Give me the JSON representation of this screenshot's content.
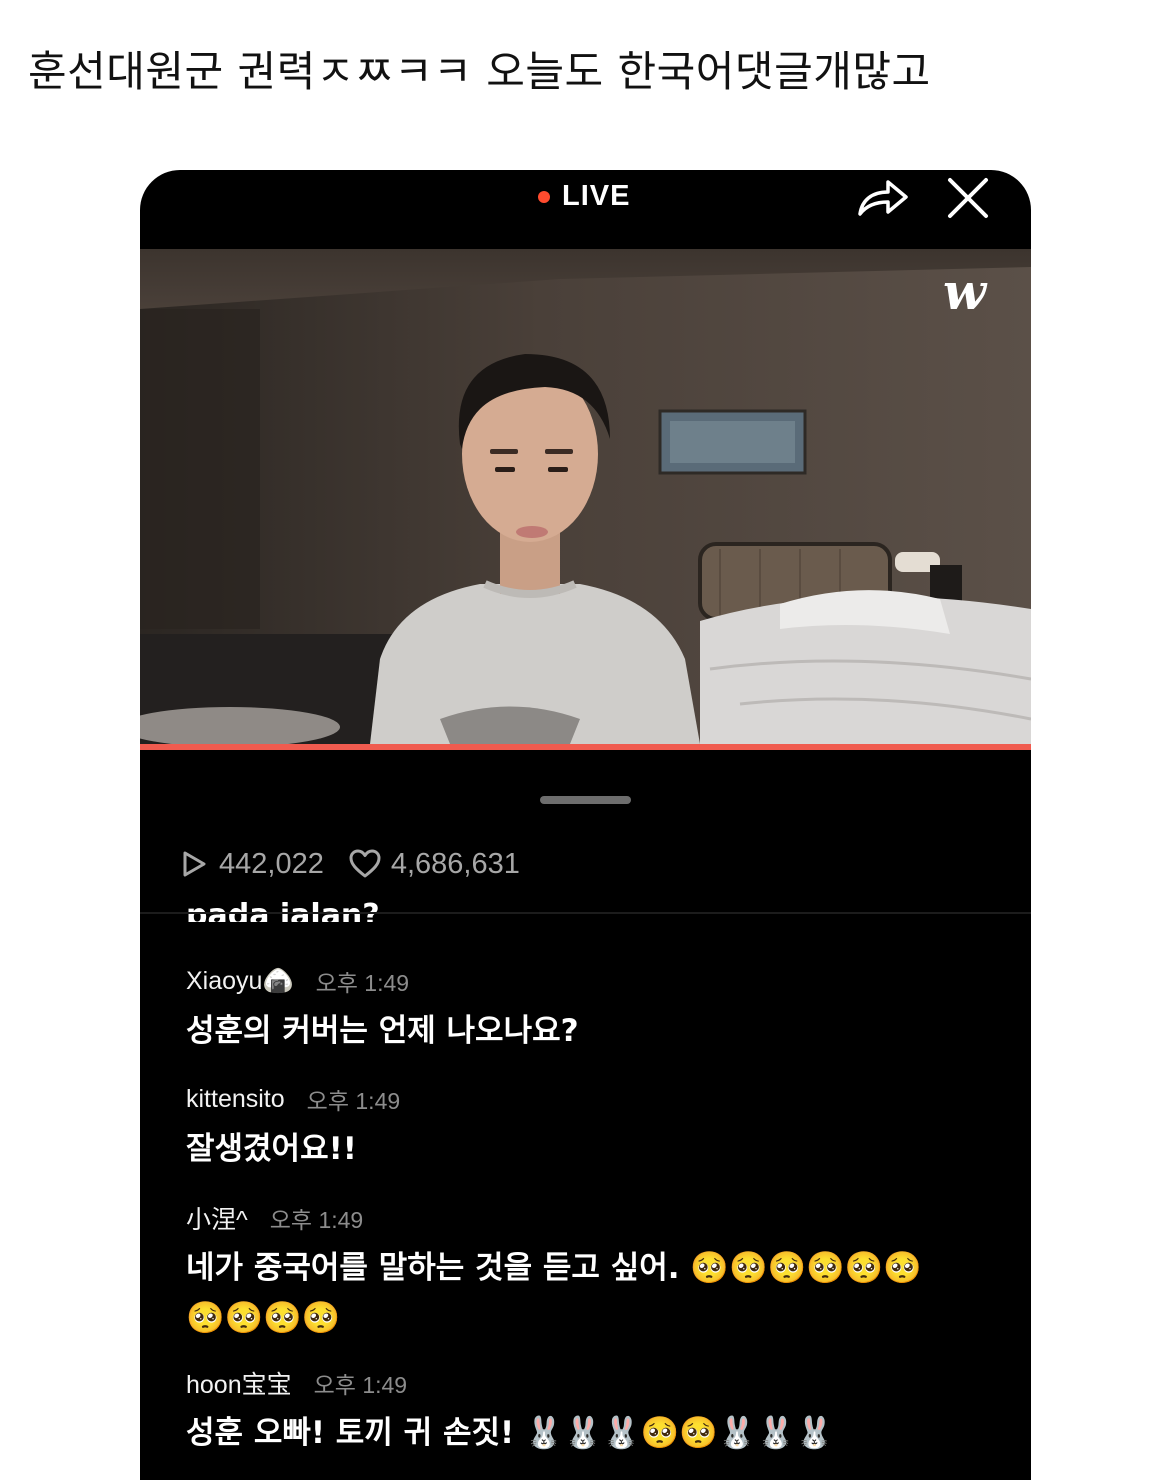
{
  "post": {
    "title": "훈선대원군 권력ㅈㅉㅋㅋ 오늘도 한국어댓글개많고"
  },
  "player": {
    "live_label": "LIVE",
    "logo_text": "w",
    "progress_fraction": 1.0,
    "stats": {
      "plays": "442,022",
      "likes": "4,686,631"
    },
    "colors": {
      "live_dot": "#ff4b2e",
      "progress": "#f05b4f"
    },
    "icons": {
      "share": "share-icon",
      "close": "close-icon",
      "play": "play-icon",
      "heart": "heart-icon"
    }
  },
  "comments": {
    "cut_off_text": "pada jalan?",
    "items": [
      {
        "user": "Xiaoyu🍙",
        "time": "오후 1:49",
        "text": "성훈의 커버는 언제 나오나요?"
      },
      {
        "user": "kittensito",
        "time": "오후 1:49",
        "text": "잘생겼어요!!"
      },
      {
        "user": "小涅^",
        "time": "오후 1:49",
        "text": "네가 중국어를 말하는 것을 듣고 싶어.",
        "emojis_line1": "🥺🥺🥺🥺🥺🥺",
        "emojis_line2": "🥺🥺🥺🥺"
      },
      {
        "user": "hoon宝宝",
        "time": "오후 1:49",
        "text": "성훈 오빠! 토끼 귀 손짓!",
        "emojis": "🐰🐰🐰🥺🥺🐰🐰🐰"
      }
    ]
  }
}
